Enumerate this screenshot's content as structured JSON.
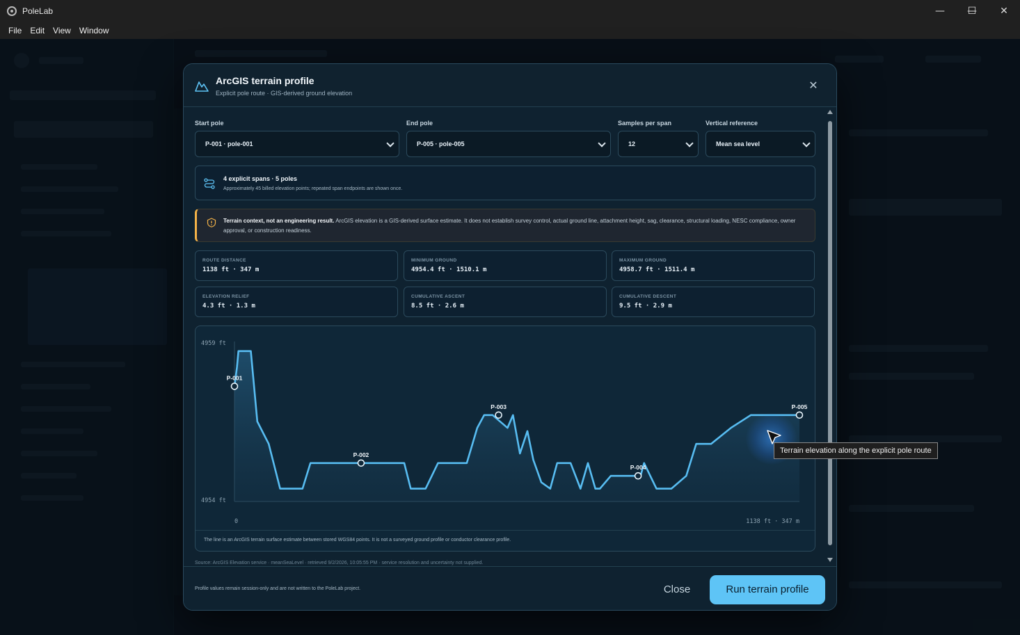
{
  "window": {
    "title": "PoleLab",
    "minimize": "—",
    "maximize": "☐",
    "close": "✕"
  },
  "menu": [
    "File",
    "Edit",
    "View",
    "Window"
  ],
  "modal": {
    "title": "ArcGIS terrain profile",
    "subtitle": "Explicit pole route · GIS-derived ground elevation",
    "close_icon": "✕",
    "fields": {
      "start_pole": {
        "label": "Start pole",
        "value": "P-001 · pole-001"
      },
      "end_pole": {
        "label": "End pole",
        "value": "P-005 · pole-005"
      },
      "samples": {
        "label": "Samples per span",
        "value": "12"
      },
      "vertical": {
        "label": "Vertical reference",
        "value": "Mean sea level"
      }
    },
    "summary": {
      "title": "4 explicit spans · 5 poles",
      "subtitle": "Approximately 45 billed elevation points; repeated span endpoints are shown once."
    },
    "warning": {
      "lead": "Terrain context, not an engineering result.",
      "body": " ArcGIS elevation is a GIS-derived surface estimate. It does not establish survey control, actual ground line, attachment height, sag, clearance, structural loading, NESC compliance, owner approval, or construction readiness."
    },
    "stats": [
      {
        "label": "ROUTE DISTANCE",
        "value": "1138 ft · 347 m"
      },
      {
        "label": "MINIMUM GROUND",
        "value": "4954.4 ft · 1510.1 m"
      },
      {
        "label": "MAXIMUM GROUND",
        "value": "4958.7 ft · 1511.4 m"
      },
      {
        "label": "ELEVATION RELIEF",
        "value": "4.3 ft · 1.3 m"
      },
      {
        "label": "CUMULATIVE ASCENT",
        "value": "8.5 ft · 2.6 m"
      },
      {
        "label": "CUMULATIVE DESCENT",
        "value": "9.5 ft · 2.9 m"
      }
    ],
    "chart_note": "The line is an ArcGIS terrain surface estimate between stored WGS84 points. It is not a surveyed ground profile or conductor clearance profile.",
    "source": "Source: ArcGIS Elevation service · meanSeaLevel · retrieved 9/2/2026, 10:05:55 PM · service resolution and uncertainty not supplied.",
    "footer_note": "Profile values remain session-only and are not written to the PoleLab project.",
    "close_button": "Close",
    "run_button": "Run terrain profile"
  },
  "tooltip": "Terrain elevation along the explicit pole route",
  "colors": {
    "accent": "#5ec4f6",
    "line": "#58bdf2",
    "warning": "#f3b248"
  },
  "chart_data": {
    "type": "area",
    "y_top_label": "4959 ft",
    "y_bottom_label": "4954 ft",
    "x_start_label": "0",
    "x_end_label": "1138 ft · 347 m",
    "ylim": [
      4954,
      4959
    ],
    "xlim": [
      0,
      1138
    ],
    "x": [
      0,
      5,
      8,
      23,
      33,
      46,
      69,
      92,
      116,
      137,
      153,
      170,
      195,
      215,
      226,
      239,
      250,
      264,
      276,
      281,
      325,
      342,
      355,
      385,
      410,
      429,
      468,
      489,
      503,
      520,
      550,
      561,
      575,
      590,
      602,
      618,
      636,
      650,
      677,
      697,
      712,
      727,
      736,
      758,
      787,
      810,
      818,
      825,
      850,
      880,
      910,
      930,
      960,
      1000,
      1040,
      1080,
      1138
    ],
    "y": [
      4957.6,
      4958.2,
      4958.7,
      4958.7,
      4958.7,
      4956.5,
      4955.8,
      4954.4,
      4954.4,
      4954.4,
      4955.2,
      4955.2,
      4955.2,
      4955.2,
      4955.2,
      4955.2,
      4955.2,
      4955.2,
      4955.2,
      4955.2,
      4955.2,
      4955.2,
      4954.4,
      4954.4,
      4955.2,
      4955.2,
      4955.2,
      4956.3,
      4956.7,
      4956.7,
      4956.3,
      4956.7,
      4955.5,
      4956.2,
      4955.3,
      4954.6,
      4954.4,
      4955.2,
      4955.2,
      4954.4,
      4955.2,
      4954.4,
      4954.4,
      4954.8,
      4954.8,
      4954.8,
      4954.8,
      4955.2,
      4954.4,
      4954.4,
      4954.8,
      4955.8,
      4955.8,
      4956.3,
      4956.7,
      4956.7,
      4956.7
    ],
    "poles": [
      {
        "name": "P-001",
        "x": 0,
        "y": 4957.6
      },
      {
        "name": "P-002",
        "x": 255,
        "y": 4955.2
      },
      {
        "name": "P-003",
        "x": 532,
        "y": 4956.7
      },
      {
        "name": "P-004",
        "x": 813,
        "y": 4954.8
      },
      {
        "name": "P-005",
        "x": 1138,
        "y": 4956.7
      }
    ]
  }
}
